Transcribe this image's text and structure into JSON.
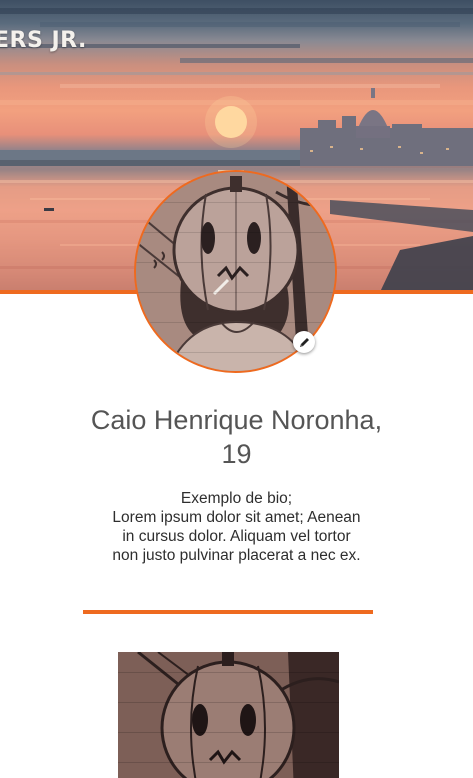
{
  "cover": {
    "title": "ERS JR.",
    "image_icon": "city-sunset-illustration"
  },
  "profile": {
    "name": "Caio Henrique Noronha,",
    "age": "19",
    "avatar_icon": "pumpkin-head-character",
    "edit_icon": "pencil-icon",
    "bio": {
      "line1": "Exemplo de bio;",
      "line2": "Lorem ipsum dolor sit amet; Aenean",
      "line3": "in cursus dolor. Aliquam vel tortor",
      "line4": "non justo pulvinar placerat a nec ex."
    }
  },
  "post": {
    "image_icon": "pumpkin-head-character"
  },
  "colors": {
    "accent": "#ee6a1f",
    "name_text": "#555555",
    "bio_text": "#2e2e2e",
    "background": "#ffffff"
  }
}
